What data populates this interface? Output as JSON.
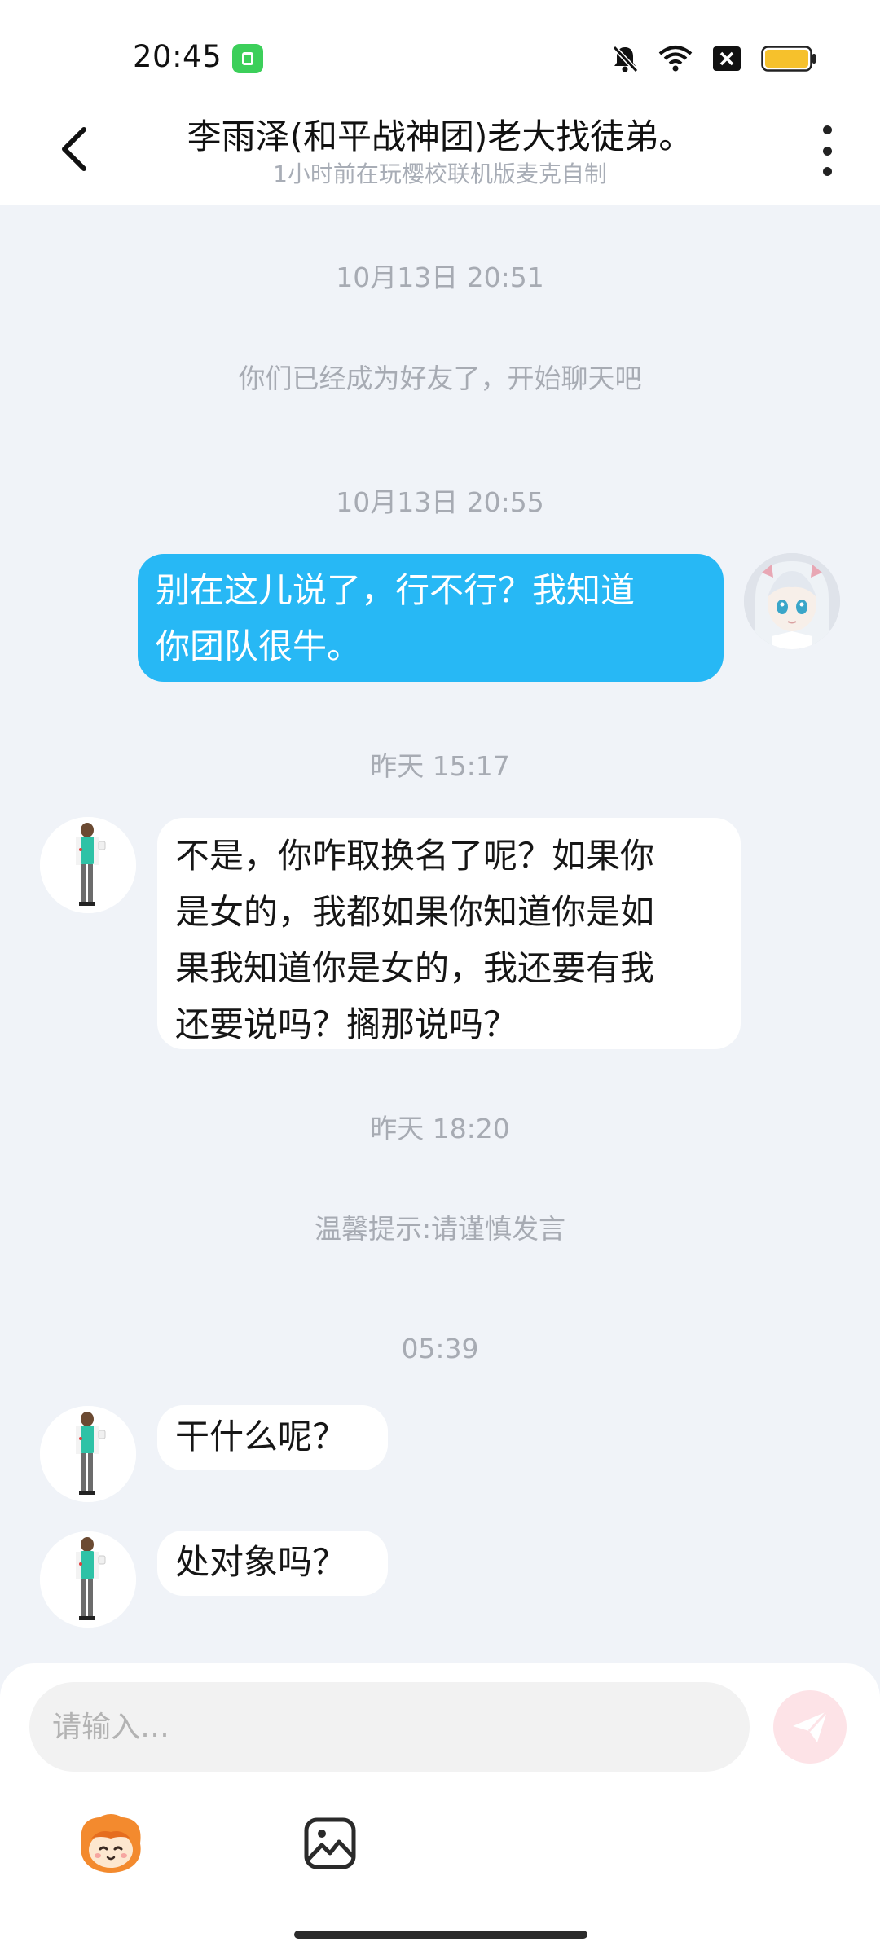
{
  "status_bar": {
    "time": "20:45",
    "icons": [
      "app-notification-icon",
      "bell-muted-icon",
      "wifi-icon",
      "sim-blocked-icon",
      "battery-icon"
    ],
    "battery_color": "#f6c12c"
  },
  "header": {
    "title": "李雨泽(和平战神团)老大找徒弟。",
    "subtitle": "1小时前在玩樱校联机版麦克自制"
  },
  "chat": {
    "items": [
      {
        "kind": "timestamp",
        "text": "10月13日 20:51"
      },
      {
        "kind": "notice",
        "text": "你们已经成为好友了，开始聊天吧"
      },
      {
        "kind": "timestamp",
        "text": "10月13日 20:55"
      },
      {
        "kind": "message",
        "side": "out",
        "lines": [
          "别在这儿说了，行不行？我知道",
          "你团队很牛。"
        ]
      },
      {
        "kind": "timestamp",
        "text": "昨天 15:17"
      },
      {
        "kind": "message",
        "side": "in",
        "lines": [
          "不是，你咋取换名了呢？如果你",
          "是女的，我都如果你知道你是如",
          "果我知道你是女的，我还要有我",
          "还要说吗？搁那说吗？"
        ]
      },
      {
        "kind": "timestamp",
        "text": "昨天 18:20"
      },
      {
        "kind": "notice",
        "text": "温馨提示:请谨慎发言"
      },
      {
        "kind": "timestamp",
        "text": "05:39"
      },
      {
        "kind": "message",
        "side": "in",
        "lines": [
          "干什么呢？"
        ]
      },
      {
        "kind": "message",
        "side": "in",
        "lines": [
          "处对象吗？"
        ]
      }
    ]
  },
  "composer": {
    "placeholder": "请输入…",
    "send_color": "#fde3e7",
    "tools": [
      "emoji-mascot-icon",
      "image-icon"
    ]
  },
  "colors": {
    "outgoing_bubble": "#27b8f5",
    "incoming_bubble": "#ffffff",
    "chat_background": "#f0f3f8"
  }
}
